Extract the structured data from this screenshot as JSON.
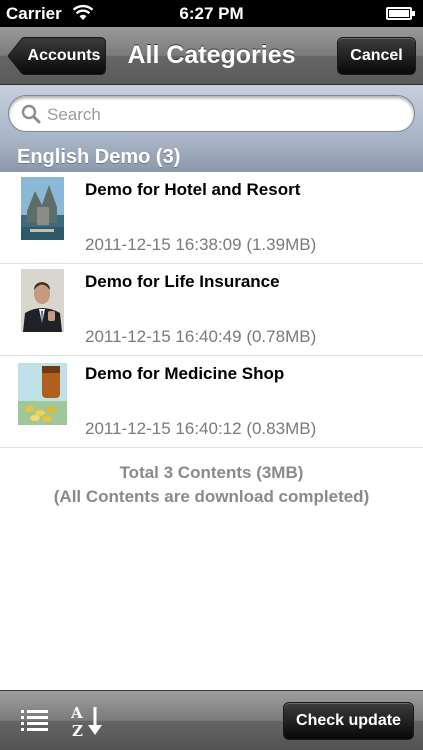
{
  "status_bar": {
    "carrier": "Carrier",
    "time": "6:27 PM"
  },
  "nav": {
    "back_label": "Accounts",
    "title": "All Categories",
    "cancel_label": "Cancel"
  },
  "search": {
    "placeholder": "Search"
  },
  "section": {
    "header": "English Demo (3)"
  },
  "items": [
    {
      "title": "Demo for Hotel and Resort",
      "meta": "2011-12-15 16:38:09 (1.39MB)"
    },
    {
      "title": "Demo for Life Insurance",
      "meta": "2011-12-15 16:40:49 (0.78MB)"
    },
    {
      "title": "Demo for Medicine Shop",
      "meta": "2011-12-15 16:40:12 (0.83MB)"
    }
  ],
  "summary": {
    "total": "Total 3 Contents (3MB)",
    "status": "(All Contents are download completed)"
  },
  "toolbar": {
    "list_icon": "list-icon",
    "sort_icon": "sort-az-icon",
    "check_update_label": "Check update"
  },
  "colors": {
    "search_bar": "#b6c0d0",
    "section_header": "#98a4b8",
    "meta_text": "#7a7a7a"
  }
}
